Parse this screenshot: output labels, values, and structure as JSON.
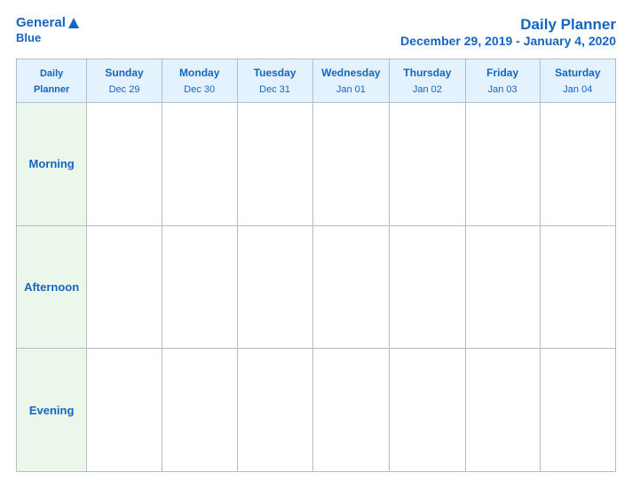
{
  "header": {
    "logo_general": "General",
    "logo_blue": "Blue",
    "title": "Daily Planner",
    "subtitle": "December 29, 2019 - January 4, 2020"
  },
  "table": {
    "label_col": {
      "line1": "Daily",
      "line2": "Planner"
    },
    "columns": [
      {
        "day": "Sunday",
        "date": "Dec 29"
      },
      {
        "day": "Monday",
        "date": "Dec 30"
      },
      {
        "day": "Tuesday",
        "date": "Dec 31"
      },
      {
        "day": "Wednesday",
        "date": "Jan 01"
      },
      {
        "day": "Thursday",
        "date": "Jan 02"
      },
      {
        "day": "Friday",
        "date": "Jan 03"
      },
      {
        "day": "Saturday",
        "date": "Jan 04"
      }
    ],
    "rows": [
      {
        "label": "Morning"
      },
      {
        "label": "Afternoon"
      },
      {
        "label": "Evening"
      }
    ]
  }
}
